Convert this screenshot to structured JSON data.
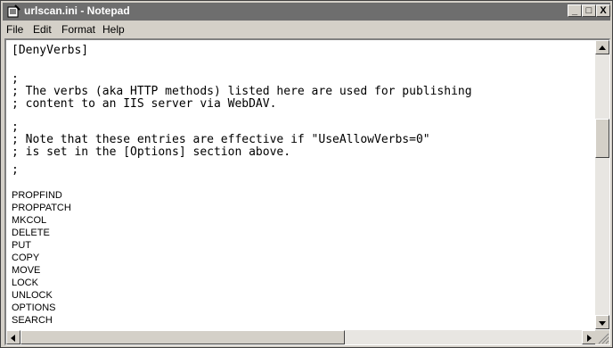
{
  "window": {
    "title": "urlscan.ini - Notepad"
  },
  "caption_buttons": {
    "minimize": "_",
    "maximize": "□",
    "close": "X"
  },
  "menu": {
    "file": "File",
    "edit": "Edit",
    "format": "Format",
    "help": "Help"
  },
  "editor": {
    "lines": [
      "[DenyVerbs]",
      "",
      ";",
      "; The verbs (aka HTTP methods) listed here are used for publishing",
      "; content to an IIS server via WebDAV.",
      ";",
      "; Note that these entries are effective if \"UseAllowVerbs=0\"",
      "; is set in the [Options] section above.",
      ";",
      "",
      "PROPFIND",
      "PROPPATCH",
      "MKCOL",
      "DELETE",
      "PUT",
      "COPY",
      "MOVE",
      "LOCK",
      "UNLOCK",
      "OPTIONS",
      "SEARCH"
    ]
  },
  "colors": {
    "titlebar": "#6e6e6e",
    "chrome": "#d4d0c8",
    "editor_bg": "#ffffff",
    "text": "#000000"
  }
}
